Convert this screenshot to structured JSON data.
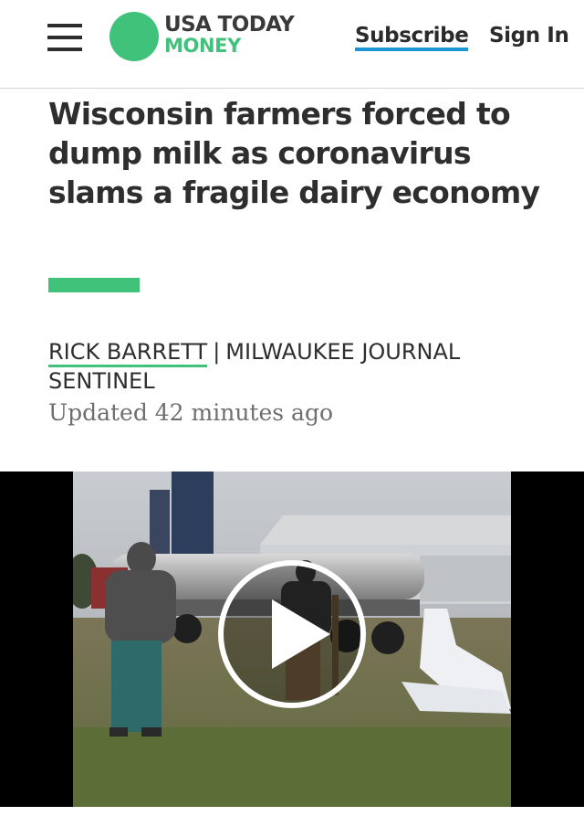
{
  "header": {
    "brand_top": "USA TODAY",
    "brand_bottom": "MONEY",
    "subscribe_label": "Subscribe",
    "signin_label": "Sign In",
    "menu_icon": "hamburger-menu-icon"
  },
  "article": {
    "headline": "Wisconsin farmers forced to dump milk as coronavirus slams a fragile dairy economy",
    "author": "RICK BARRETT",
    "separator": "|",
    "publication": "MILWAUKEE JOURNAL SENTINEL",
    "updated": "Updated 42 minutes ago"
  },
  "video": {
    "play_icon": "play-icon"
  },
  "colors": {
    "brand_green": "#41c27a",
    "subscribe_underline": "#1a96d4",
    "text_dark": "#2e2e2e",
    "text_muted": "#6f6f6f"
  }
}
